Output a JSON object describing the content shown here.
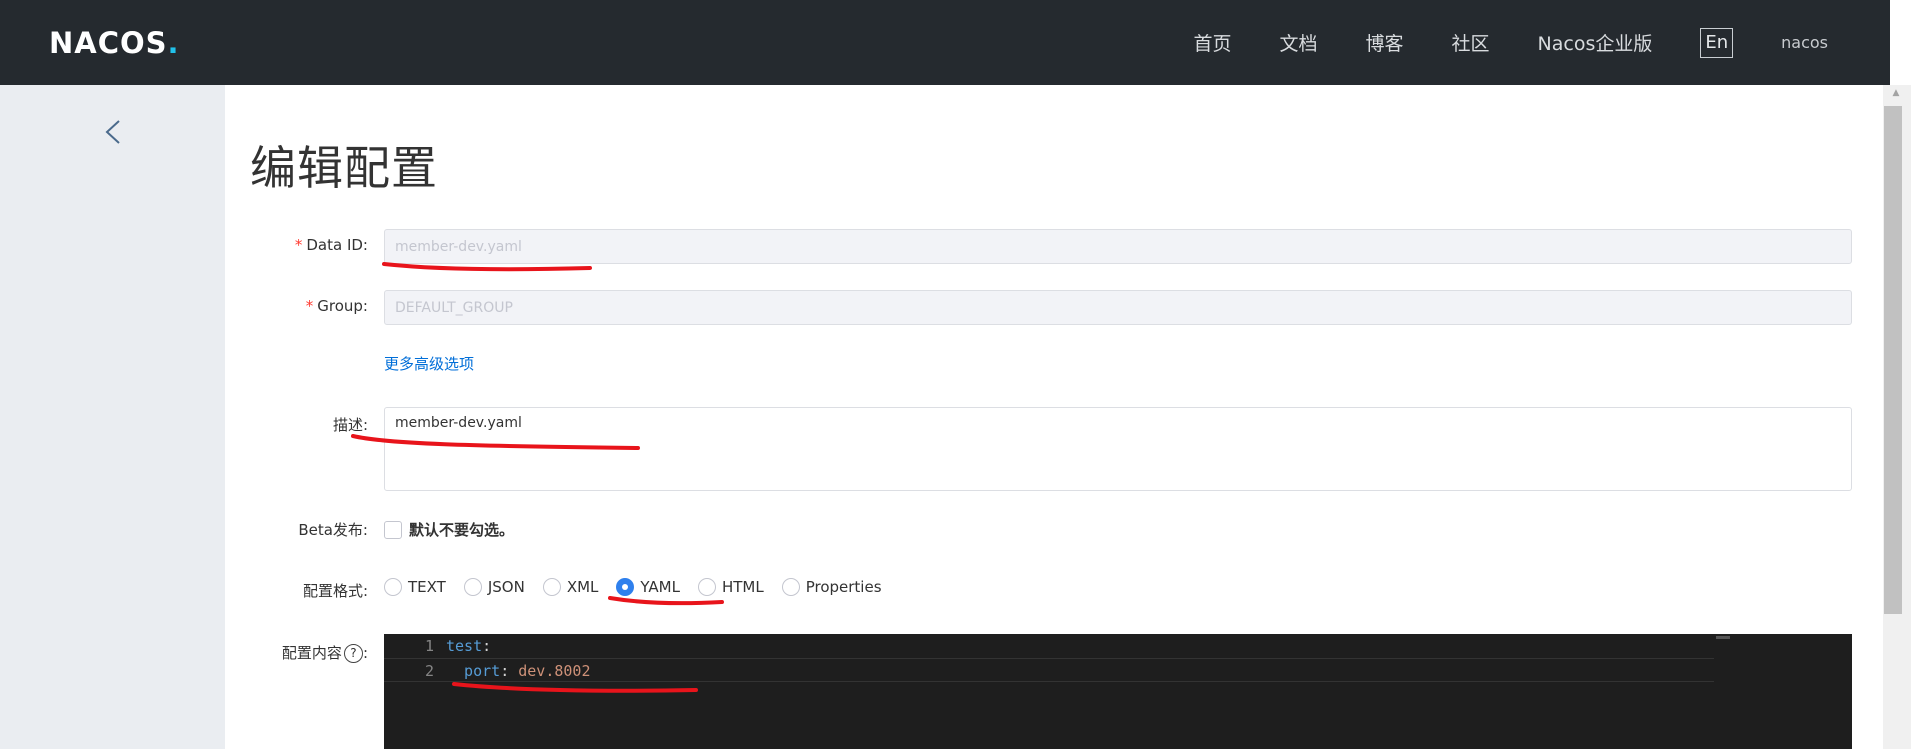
{
  "header": {
    "logo": "NACOS",
    "logo_dot": ".",
    "nav": [
      "首页",
      "文档",
      "博客",
      "社区",
      "Nacos企业版"
    ],
    "lang": "En",
    "user": "nacos"
  },
  "page": {
    "title": "编辑配置"
  },
  "form": {
    "data_id": {
      "label": "Data ID:",
      "value": "member-dev.yaml"
    },
    "group": {
      "label": "Group:",
      "value": "DEFAULT_GROUP"
    },
    "advanced_link": "更多高级选项",
    "description": {
      "label": "描述:",
      "value": "member-dev.yaml"
    },
    "beta": {
      "label": "Beta发布:",
      "checkbox_text": "默认不要勾选。"
    },
    "format": {
      "label": "配置格式:",
      "options": [
        "TEXT",
        "JSON",
        "XML",
        "YAML",
        "HTML",
        "Properties"
      ],
      "selected": "YAML"
    },
    "content": {
      "label": "配置内容",
      "help": "?",
      "colon": ":",
      "lines": [
        {
          "no": "1",
          "key": "test",
          "sep": ":",
          "value": ""
        },
        {
          "no": "2",
          "key": "  port",
          "sep": ": ",
          "value": "dev.8002"
        }
      ]
    }
  },
  "colors": {
    "header_bg": "#252a2f",
    "sidebar_bg": "#eaedf1",
    "link": "#006ed8",
    "required": "#ff3a30",
    "radio_checked": "#2f80ed",
    "annotation": "#e8141b"
  }
}
